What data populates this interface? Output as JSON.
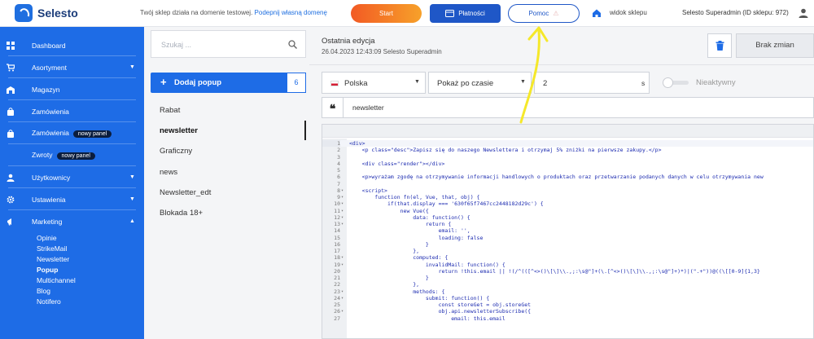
{
  "header": {
    "logo_text": "Selesto",
    "notice_text": "Twój sklep działa na domenie testowej.",
    "notice_link": "Podepnij własną domenę",
    "start_label": "Start",
    "payments_label": "Płatności",
    "help_label": "Pomoc",
    "shop_view_label": "widok sklepu",
    "user_info": "Selesto Superadmin (ID sklepu: 972)",
    "accent": "#1e6ce6"
  },
  "sidebar": {
    "items": [
      {
        "label": "Dashboard",
        "icon": "grid-icon"
      },
      {
        "label": "Asortyment",
        "icon": "cart-icon"
      },
      {
        "label": "Magazyn",
        "icon": "warehouse-icon"
      },
      {
        "label": "Zamówienia",
        "icon": "bag-icon"
      },
      {
        "label": "Zamówienia",
        "icon": "bag-icon",
        "badge": "nowy panel"
      },
      {
        "label": "Zwroty",
        "badge": "nowy panel"
      },
      {
        "label": "Użytkownicy",
        "icon": "user-icon"
      },
      {
        "label": "Ustawienia",
        "icon": "gear-icon"
      },
      {
        "label": "Marketing",
        "icon": "megaphone-icon"
      }
    ],
    "marketing_sub": [
      "Opinie",
      "StrikeMail",
      "Newsletter",
      "Popup",
      "Multichannel",
      "Blog",
      "Notifero"
    ]
  },
  "popups": {
    "search_placeholder": "Szukaj ...",
    "add_label": "Dodaj popup",
    "count": "6",
    "list": [
      "Rabat",
      "newsletter",
      "Graficzny",
      "news",
      "Newsletter_edt",
      "Blokada 18+"
    ]
  },
  "editor": {
    "last_edit_title": "Ostatnia edycja",
    "last_edit_meta": "26.04.2023  12:43:09    Selesto Superadmin",
    "no_changes_label": "Brak zmian",
    "country": "Polska",
    "show_mode": "Pokaż po czasie",
    "delay_value": "2",
    "delay_unit": "s",
    "active_label": "Nieaktywny",
    "quote_glyph": "❝",
    "popup_name": "newsletter",
    "code_lines": [
      {
        "n": "1",
        "fold": "",
        "code": "<div>"
      },
      {
        "n": "2",
        "fold": "",
        "code": "    <p class=\"desc\">Zapisz się do naszego Newslettera i otrzymaj 5% zniżki na pierwsze zakupy.</p>"
      },
      {
        "n": "3",
        "fold": "",
        "code": ""
      },
      {
        "n": "4",
        "fold": "",
        "code": "    <div class=\"render\"></div>"
      },
      {
        "n": "5",
        "fold": "",
        "code": ""
      },
      {
        "n": "6",
        "fold": "",
        "code": "    <p>wyrażam zgodę na otrzymywanie informacji handlowych o produktach oraz przetwarzanie podanych danych w celu otrzymywania new"
      },
      {
        "n": "7",
        "fold": "",
        "code": ""
      },
      {
        "n": "8",
        "fold": "▾",
        "code": "    <script>"
      },
      {
        "n": "9",
        "fold": "▾",
        "code": "        function fn(el, Vue, that, obj) {"
      },
      {
        "n": "10",
        "fold": "▾",
        "code": "            if(that.display === '630f65f7467cc2448182d29c') {"
      },
      {
        "n": "11",
        "fold": "▾",
        "code": "                new Vue({"
      },
      {
        "n": "12",
        "fold": "▾",
        "code": "                    data: function() {"
      },
      {
        "n": "13",
        "fold": "▾",
        "code": "                        return {"
      },
      {
        "n": "14",
        "fold": "",
        "code": "                            email: '',"
      },
      {
        "n": "15",
        "fold": "",
        "code": "                            loading: false"
      },
      {
        "n": "16",
        "fold": "",
        "code": "                        }"
      },
      {
        "n": "17",
        "fold": "",
        "code": "                    },"
      },
      {
        "n": "18",
        "fold": "▾",
        "code": "                    computed: {"
      },
      {
        "n": "19",
        "fold": "▾",
        "code": "                        invalidMail: function() {"
      },
      {
        "n": "20",
        "fold": "",
        "code": "                            return !this.email || !(/^(([^<>()\\[\\]\\\\.,;:\\s@\"]+(\\.[^<>()\\[\\]\\\\.,;:\\s@\"]+)*)|(\".+\"))@((\\[[0-9]{1,3}"
      },
      {
        "n": "21",
        "fold": "",
        "code": "                        }"
      },
      {
        "n": "22",
        "fold": "",
        "code": "                    },"
      },
      {
        "n": "23",
        "fold": "▾",
        "code": "                    methods: {"
      },
      {
        "n": "24",
        "fold": "▾",
        "code": "                        submit: function() {"
      },
      {
        "n": "25",
        "fold": "",
        "code": "                            const storeGet = obj.storeGet"
      },
      {
        "n": "26",
        "fold": "▾",
        "code": "                            obj.api.newsletterSubscribe({"
      },
      {
        "n": "27",
        "fold": "",
        "code": "                                email: this.email"
      }
    ]
  }
}
